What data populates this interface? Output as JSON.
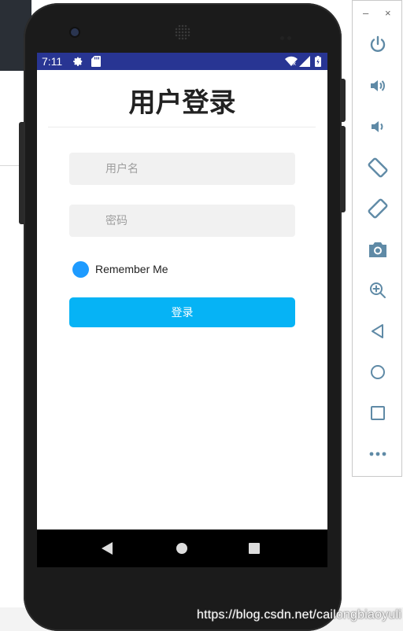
{
  "status_bar": {
    "time": "7:11"
  },
  "page": {
    "title": "用户登录",
    "username_placeholder": "用户名",
    "password_placeholder": "密码",
    "remember_label": "Remember Me",
    "login_label": "登录"
  },
  "emulator": {
    "minimize": "–",
    "close": "×",
    "controls": [
      "power-icon",
      "volume-up-icon",
      "volume-down-icon",
      "rotate-left-icon",
      "rotate-right-icon",
      "camera-icon",
      "zoom-icon",
      "back-icon",
      "home-icon",
      "overview-icon",
      "more-icon"
    ]
  },
  "watermark": "https://blog.csdn.net/cailongbiaoyuli",
  "colors": {
    "status_bar": "#283593",
    "login_button": "#06b3f5",
    "radio": "#1e9bff",
    "field_bg": "#f1f1f1",
    "emulator_icon": "#5f8aa6"
  }
}
